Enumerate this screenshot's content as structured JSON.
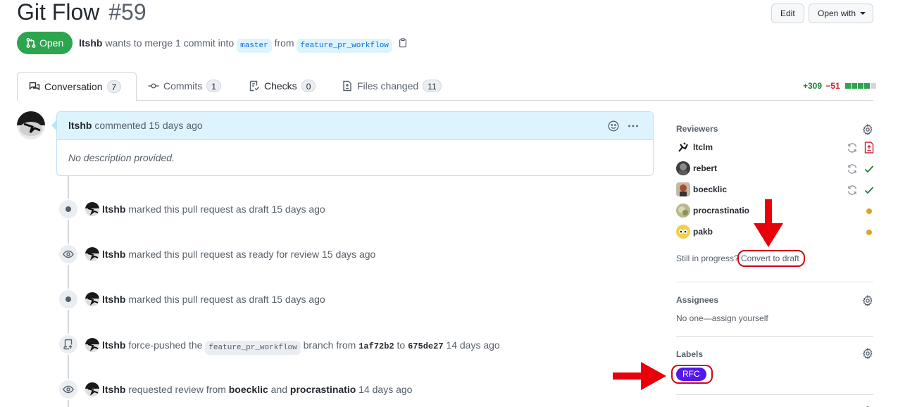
{
  "pr": {
    "title": "Git Flow",
    "number": "#59",
    "state": "Open",
    "author": "ltshb",
    "merge_text": "wants to merge 1 commit into",
    "base_branch": "master",
    "from_text": "from",
    "head_branch": "feature_pr_workflow"
  },
  "header_buttons": {
    "edit": "Edit",
    "open_with": "Open with"
  },
  "tabs": [
    {
      "label": "Conversation",
      "count": "7"
    },
    {
      "label": "Commits",
      "count": "1"
    },
    {
      "label": "Checks",
      "count": "0"
    },
    {
      "label": "Files changed",
      "count": "11"
    }
  ],
  "diffstat": {
    "additions": "+309",
    "deletions": "−51"
  },
  "comment": {
    "author": "ltshb",
    "action": "commented 15 days ago",
    "body": "No description provided."
  },
  "events": [
    {
      "author": "ltshb",
      "text": "marked this pull request as draft 15 days ago",
      "icon": "dot-icon"
    },
    {
      "author": "ltshb",
      "text": "marked this pull request as ready for review 15 days ago",
      "icon": "eye-icon"
    },
    {
      "author": "ltshb",
      "text": "marked this pull request as draft 15 days ago",
      "icon": "dot-icon"
    },
    {
      "author": "ltshb",
      "text_before": "force-pushed the",
      "branch": "feature_pr_workflow",
      "text_mid": "branch from",
      "from_sha": "1af72b2",
      "to_text": "to",
      "to_sha": "675de27",
      "time": "14 days ago",
      "icon": "repo-push-icon"
    },
    {
      "author": "ltshb",
      "text_before": "requested review from",
      "user1": "boecklic",
      "and_text": "and",
      "user2": "procrastinatio",
      "time": "14 days ago",
      "icon": "eye-icon"
    }
  ],
  "sidebar": {
    "reviewers": {
      "heading": "Reviewers",
      "items": [
        {
          "name": "ltclm",
          "status": "changes-requested"
        },
        {
          "name": "rebert",
          "status": "approved"
        },
        {
          "name": "boecklic",
          "status": "approved"
        },
        {
          "name": "procrastinatio",
          "status": "pending"
        },
        {
          "name": "pakb",
          "status": "pending"
        }
      ],
      "still_text": "Still in progress?",
      "convert_link": "Convert to draft"
    },
    "assignees": {
      "heading": "Assignees",
      "text": "No one—assign yourself"
    },
    "labels": {
      "heading": "Labels",
      "items": [
        {
          "name": "RFC",
          "color": "#5319e7"
        }
      ]
    }
  },
  "colors": {
    "open_green": "#2da44e",
    "link_blue": "#0969da",
    "annotation_red": "#e8000b"
  }
}
